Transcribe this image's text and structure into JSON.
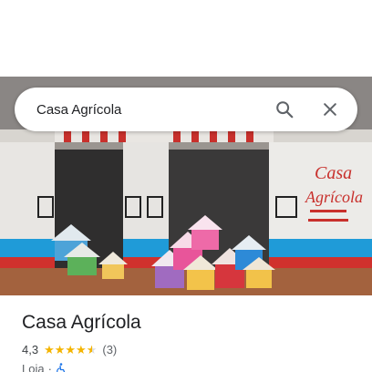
{
  "search": {
    "query": "Casa Agrícola",
    "search_icon": "search-icon",
    "clear_icon": "close-icon"
  },
  "photo": {
    "sign_line1": "Casa",
    "sign_line2": "Agrícola"
  },
  "place": {
    "name": "Casa Agrícola",
    "rating": "4,3",
    "stars": 4.5,
    "review_count": "(3)",
    "category": "Loja",
    "separator": "·",
    "accessibility_icon": "wheelchair-icon"
  },
  "colors": {
    "star": "#f4b400",
    "accessibility": "#1a73e8",
    "title_text": "#202124"
  }
}
